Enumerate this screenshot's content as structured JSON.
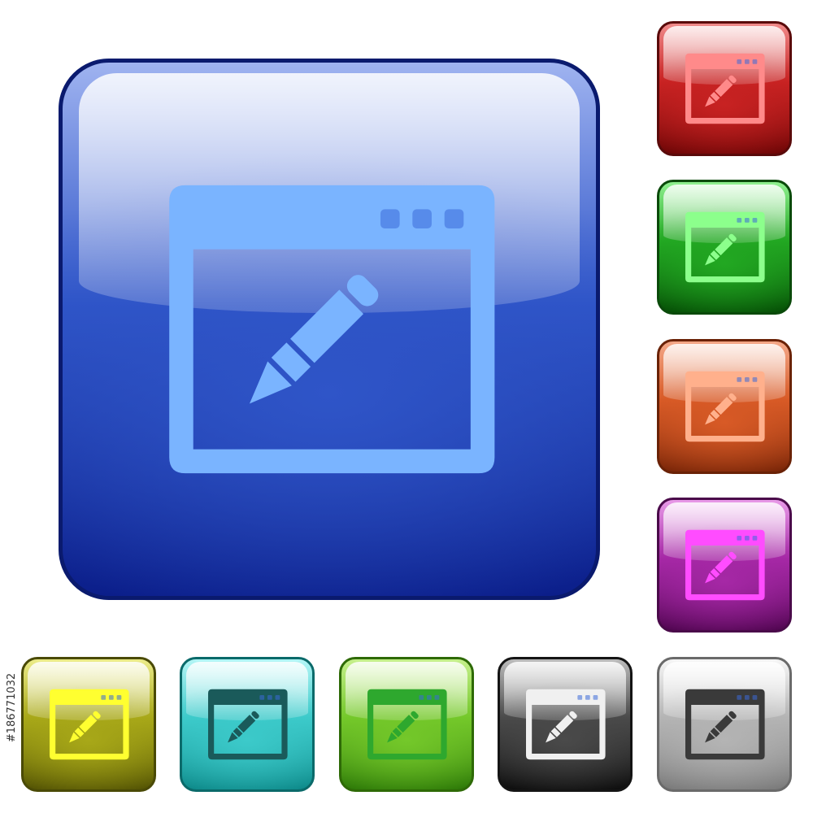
{
  "stock_id": "#186771032",
  "tiles": [
    {
      "name": "blue-browser-edit-button",
      "size": "large",
      "border": "#0a1a6e",
      "top": "#9fb3f0",
      "mid": "#2f55c8",
      "bottom": "#0b1e8a",
      "glyph": "#7ab4ff",
      "icon": "browser-edit-icon"
    },
    {
      "name": "red-browser-edit-button",
      "size": "small",
      "border": "#5a0a0a",
      "top": "#f08a8a",
      "mid": "#c82222",
      "bottom": "#6e0606",
      "glyph": "#ff8a8a",
      "icon": "browser-edit-icon"
    },
    {
      "name": "green-browser-edit-button",
      "size": "small",
      "border": "#0a4a0a",
      "top": "#8ff08f",
      "mid": "#22a822",
      "bottom": "#065006",
      "glyph": "#8cff8c",
      "icon": "browser-edit-icon"
    },
    {
      "name": "orange-browser-edit-button",
      "size": "small",
      "border": "#6a2206",
      "top": "#f4a888",
      "mid": "#d85a26",
      "bottom": "#7a2608",
      "glyph": "#ffb08c",
      "icon": "browser-edit-icon"
    },
    {
      "name": "purple-browser-edit-button",
      "size": "small",
      "border": "#4a0a4a",
      "top": "#e89ae8",
      "mid": "#a628a6",
      "bottom": "#520652",
      "glyph": "#ff4cff",
      "icon": "browser-edit-icon"
    },
    {
      "name": "yellow-browser-edit-button",
      "size": "small",
      "border": "#4a4a06",
      "top": "#ecec8a",
      "mid": "#a8a818",
      "bottom": "#545404",
      "glyph": "#ffff30",
      "icon": "browser-edit-icon"
    },
    {
      "name": "cyan-browser-edit-button",
      "size": "small",
      "border": "#0a6a6a",
      "top": "#b4f6f6",
      "mid": "#3ccaca",
      "bottom": "#0e8a8a",
      "glyph": "#1a5a5a",
      "icon": "browser-edit-icon"
    },
    {
      "name": "lime-browser-edit-button",
      "size": "small",
      "border": "#2e6a06",
      "top": "#c6f08c",
      "mid": "#74c82a",
      "bottom": "#2e7a08",
      "glyph": "#2ea82e",
      "icon": "browser-edit-icon"
    },
    {
      "name": "black-browser-edit-button",
      "size": "small",
      "border": "#141414",
      "top": "#bcbcbc",
      "mid": "#4a4a4a",
      "bottom": "#0e0e0e",
      "glyph": "#f0f0f0",
      "icon": "browser-edit-icon"
    },
    {
      "name": "gray-browser-edit-button",
      "size": "small",
      "border": "#6a6a6a",
      "top": "#f6f6f6",
      "mid": "#b4b4b4",
      "bottom": "#7a7a7a",
      "glyph": "#3a3a3a",
      "icon": "browser-edit-icon"
    }
  ]
}
